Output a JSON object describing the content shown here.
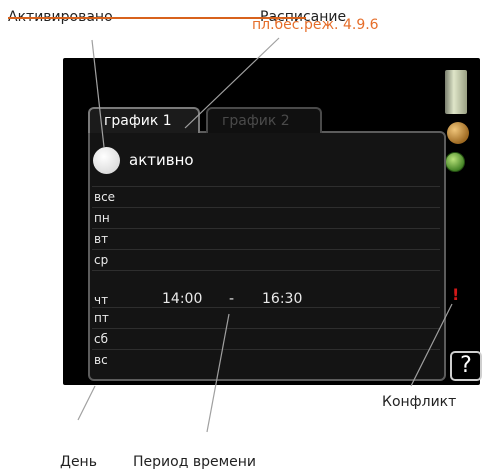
{
  "annotations": {
    "activated": "Активировано",
    "schedule": "Расписание",
    "conflict": "Конфликт",
    "day": "День",
    "time_period": "Период времени"
  },
  "screen": {
    "menu_title": "пл.бес.реж. 4.9.6",
    "tabs": [
      {
        "label": "график 1",
        "selected": true
      },
      {
        "label": "график 2",
        "selected": false
      }
    ],
    "active_label": "активно",
    "days": [
      "все",
      "пн",
      "вт",
      "ср",
      "чт",
      "пт",
      "сб",
      "вс"
    ],
    "period": {
      "day": "чт",
      "start": "14:00",
      "separator": "-",
      "end": "16:30"
    },
    "conflict_marker": "!",
    "help": "?"
  },
  "colors": {
    "accent_orange": "#e66e2a",
    "conflict_red": "#d21818"
  }
}
